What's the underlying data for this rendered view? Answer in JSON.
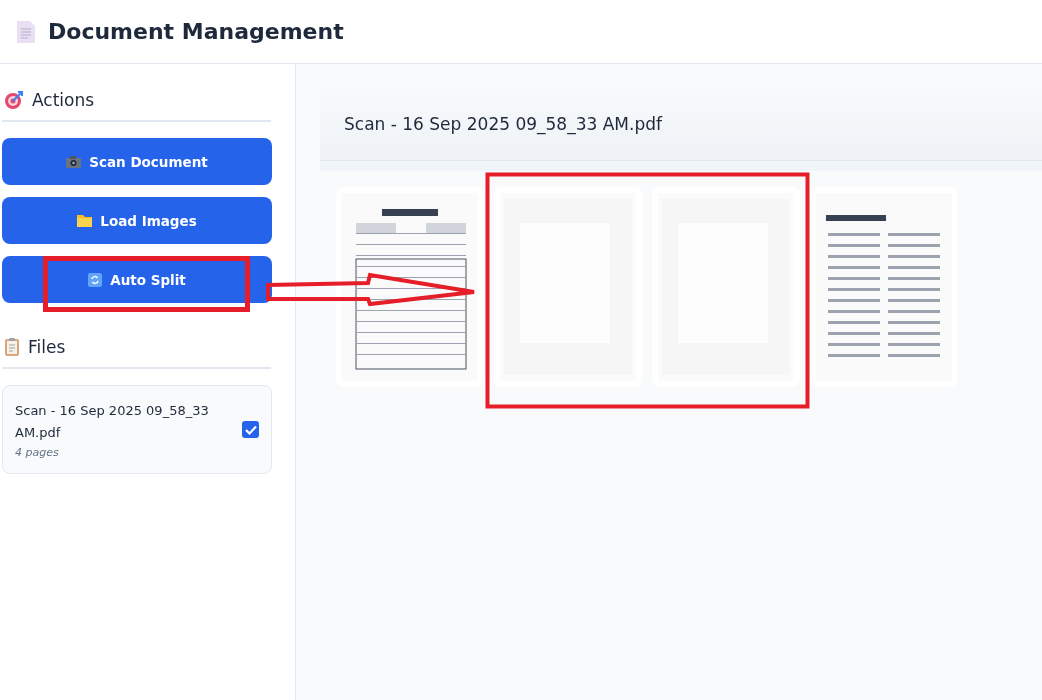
{
  "header": {
    "title": "Document Management"
  },
  "sidebar": {
    "actions_heading": "Actions",
    "actions": [
      {
        "kind": "camera",
        "label": "Scan Document"
      },
      {
        "kind": "folder",
        "label": "Load Images"
      },
      {
        "kind": "split",
        "label": "Auto Split"
      }
    ],
    "files_heading": "Files",
    "files": [
      {
        "name": "Scan - 16 Sep 2025 09_58_33 AM.pdf",
        "pages": "4 pages",
        "checked": true
      }
    ]
  },
  "document": {
    "title": "Scan - 16 Sep 2025 09_58_33 AM.pdf"
  }
}
